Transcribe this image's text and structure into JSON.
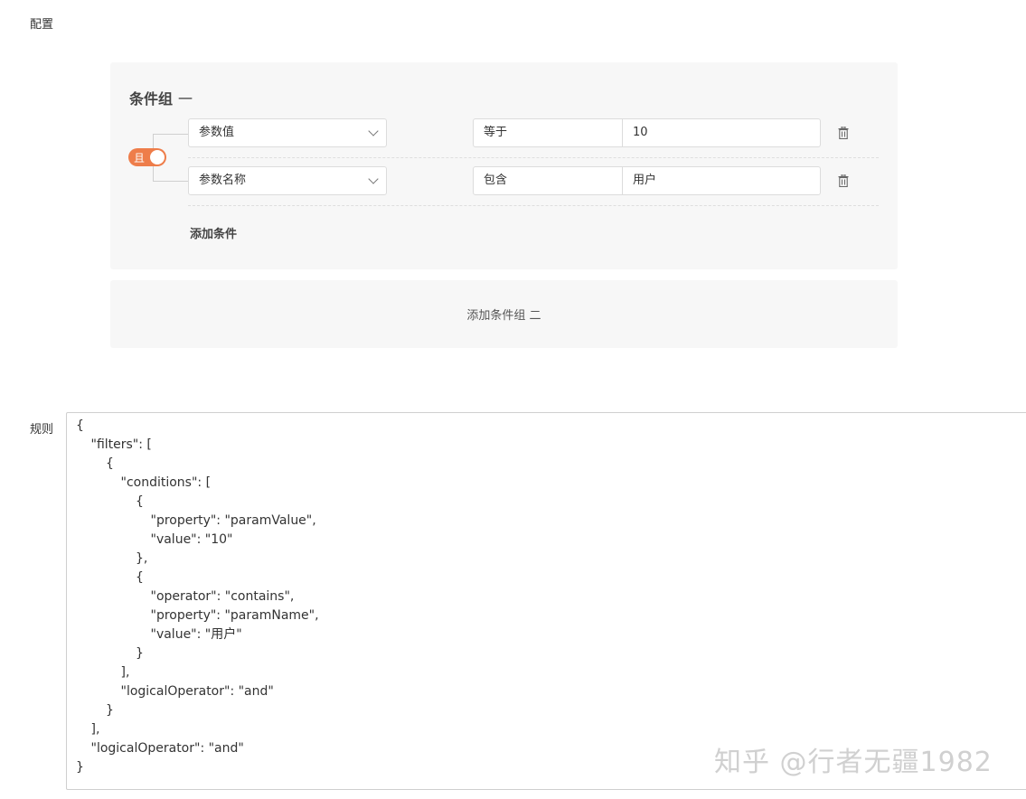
{
  "config_label": "配置",
  "rules_label": "规则",
  "group": {
    "title": "条件组",
    "number": "一",
    "logical_toggle": "且",
    "conditions": [
      {
        "property": "参数值",
        "operator": "等于",
        "value": "10"
      },
      {
        "property": "参数名称",
        "operator": "包含",
        "value": "用户"
      }
    ],
    "add_condition": "添加条件"
  },
  "add_group": "添加条件组 二",
  "code_lines": [
    {
      "indent": 0,
      "text": "{"
    },
    {
      "indent": 1,
      "text": "\"filters\": ["
    },
    {
      "indent": 2,
      "text": "{"
    },
    {
      "indent": 3,
      "text": "\"conditions\": ["
    },
    {
      "indent": 4,
      "text": "{"
    },
    {
      "indent": 5,
      "text": "\"property\": \"paramValue\","
    },
    {
      "indent": 5,
      "text": "\"value\": \"10\""
    },
    {
      "indent": 4,
      "text": "},"
    },
    {
      "indent": 4,
      "text": "{"
    },
    {
      "indent": 5,
      "text": "\"operator\": \"contains\","
    },
    {
      "indent": 5,
      "text": "\"property\": \"paramName\","
    },
    {
      "indent": 5,
      "text": "\"value\": \"用户\""
    },
    {
      "indent": 4,
      "text": "}"
    },
    {
      "indent": 3,
      "text": "],"
    },
    {
      "indent": 3,
      "text": "\"logicalOperator\": \"and\""
    },
    {
      "indent": 2,
      "text": "}"
    },
    {
      "indent": 1,
      "text": "],"
    },
    {
      "indent": 1,
      "text": "\"logicalOperator\": \"and\""
    },
    {
      "indent": 0,
      "text": "}"
    }
  ],
  "watermark": "知乎 @行者无疆1982",
  "icons": {
    "toggle": "switch-on",
    "dropdown": "chevron-down-icon",
    "delete": "trash-icon"
  },
  "colors": {
    "accent": "#ee7d4a",
    "panel_bg": "#f7f7f7"
  }
}
